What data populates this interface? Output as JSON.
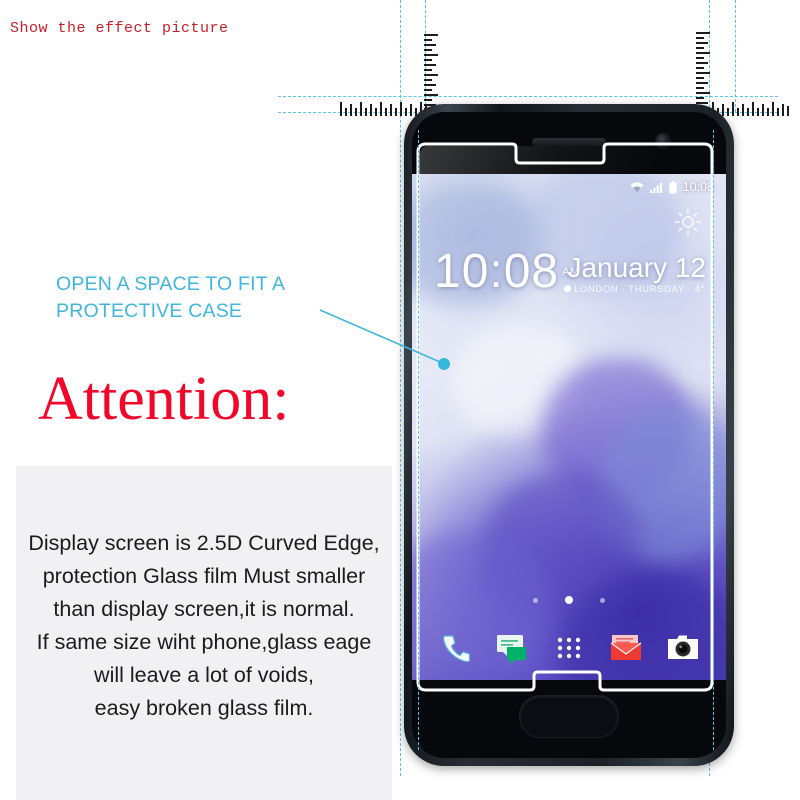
{
  "top_label": "Show the effect picture",
  "callout": {
    "line1": "OPEN A SPACE TO FIT A",
    "line2": "PROTECTIVE CASE",
    "color": "#41b6dd"
  },
  "attention": {
    "text": "Attention:",
    "color": "#f2072b"
  },
  "warning": {
    "lines": [
      "Display screen is 2.5D Curved Edge,",
      "protection Glass film Must smaller",
      "than display screen,it is normal.",
      "If same size wiht phone,glass eage",
      "will leave a lot of voids,",
      "easy broken glass film."
    ],
    "panel_color": "#f1f0f2",
    "text_color": "#1b1b1b"
  },
  "guides": {
    "color": "#57c3e6",
    "ruler_color": "#1d1d1d"
  },
  "phone": {
    "body_color": "#1b2127",
    "screen": {
      "status_bar": {
        "wifi_icon": "wifi-icon",
        "signal_icon": "signal-bars-icon",
        "battery_icon": "battery-icon",
        "time": "10:08"
      },
      "weather_icon": "sun-icon",
      "clock": {
        "time": "10:08",
        "ampm": "AM"
      },
      "date": "January 12",
      "date_sub": "LONDON · THURSDAY · 4°",
      "location_icon": "location-pin-icon",
      "page_dots": 3,
      "active_dot_index": 1,
      "dock": [
        {
          "name": "phone-app-icon",
          "label": "Phone"
        },
        {
          "name": "messages-app-icon",
          "label": "Messages"
        },
        {
          "name": "app-drawer-icon",
          "label": "Apps"
        },
        {
          "name": "gmail-app-icon",
          "label": "Mail"
        },
        {
          "name": "camera-app-icon",
          "label": "Camera"
        }
      ]
    },
    "home_button": "home-button",
    "earpiece": "earpiece-speaker",
    "front_camera": "front-camera"
  }
}
